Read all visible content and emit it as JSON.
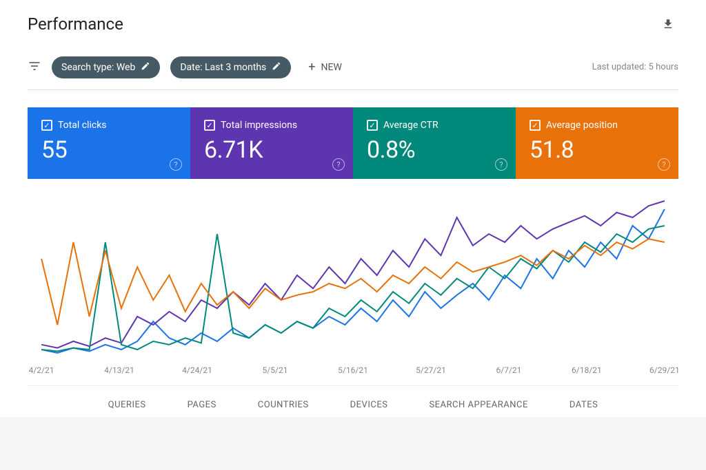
{
  "header": {
    "title": "Performance"
  },
  "filters": {
    "search_type_chip": "Search type: Web",
    "date_chip": "Date: Last 3 months",
    "new_label": "NEW",
    "last_updated": "Last updated: 5 hours"
  },
  "metrics": {
    "clicks": {
      "label": "Total clicks",
      "value": "55",
      "color": "#1a73e8"
    },
    "impressions": {
      "label": "Total impressions",
      "value": "6.71K",
      "color": "#5e35b1"
    },
    "ctr": {
      "label": "Average CTR",
      "value": "0.8%",
      "color": "#00897b"
    },
    "position": {
      "label": "Average position",
      "value": "51.8",
      "color": "#e8710a"
    }
  },
  "tabs": {
    "queries": "QUERIES",
    "pages": "PAGES",
    "countries": "COUNTRIES",
    "devices": "DEVICES",
    "search_appearance": "SEARCH APPEARANCE",
    "dates": "DATES"
  },
  "chart_data": {
    "type": "line",
    "xlabel": "",
    "ylabel": "",
    "x_ticks": [
      "4/2/21",
      "4/13/21",
      "4/24/21",
      "5/5/21",
      "5/16/21",
      "5/27/21",
      "6/7/21",
      "6/18/21",
      "6/29/21"
    ],
    "series": [
      {
        "name": "Total clicks",
        "color": "#1a73e8",
        "values": [
          5,
          3,
          6,
          4,
          8,
          5,
          10,
          22,
          12,
          8,
          15,
          10,
          18,
          12,
          20,
          15,
          22,
          18,
          25,
          20,
          30,
          22,
          35,
          25,
          40,
          30,
          38,
          45,
          35,
          50,
          42,
          60,
          48,
          65,
          55,
          70,
          60,
          80,
          72,
          90
        ]
      },
      {
        "name": "Total impressions",
        "color": "#5e35b1",
        "values": [
          8,
          6,
          10,
          7,
          12,
          9,
          25,
          20,
          28,
          22,
          35,
          30,
          40,
          32,
          45,
          35,
          50,
          42,
          55,
          45,
          60,
          50,
          65,
          55,
          72,
          62,
          85,
          68,
          75,
          70,
          80,
          72,
          78,
          82,
          86,
          80,
          88,
          85,
          92,
          95
        ]
      },
      {
        "name": "Average CTR",
        "color": "#00897b",
        "values": [
          5,
          4,
          6,
          5,
          70,
          8,
          5,
          10,
          8,
          12,
          9,
          75,
          15,
          12,
          20,
          15,
          22,
          18,
          30,
          25,
          35,
          28,
          40,
          33,
          45,
          38,
          48,
          42,
          55,
          48,
          60,
          54,
          65,
          58,
          70,
          64,
          75,
          70,
          78,
          80
        ]
      },
      {
        "name": "Average position",
        "color": "#e8710a",
        "values": [
          60,
          20,
          70,
          25,
          65,
          30,
          55,
          35,
          50,
          28,
          45,
          32,
          40,
          30,
          42,
          35,
          38,
          40,
          45,
          42,
          48,
          40,
          50,
          45,
          55,
          48,
          58,
          52,
          55,
          58,
          62,
          56,
          65,
          60,
          68,
          62,
          70,
          66,
          72,
          70
        ]
      }
    ],
    "ylim": [
      0,
      100
    ]
  }
}
